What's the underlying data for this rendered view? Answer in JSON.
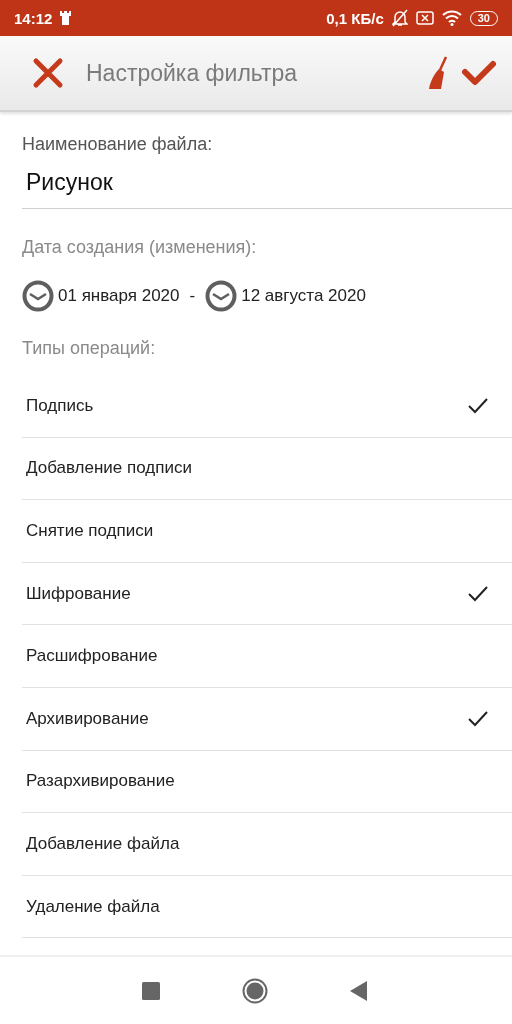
{
  "status_bar": {
    "time": "14:12",
    "speed": "0,1 КБ/с",
    "battery": "30"
  },
  "toolbar": {
    "title": "Настройка фильтра"
  },
  "file_name": {
    "label": "Наименование файла:",
    "value": "Рисунок"
  },
  "date_range": {
    "label": "Дата создания (изменения):",
    "from": "01 января 2020",
    "separator": "-",
    "to": "12 августа 2020"
  },
  "operations": {
    "label": "Типы операций:",
    "items": [
      {
        "label": "Подпись",
        "checked": true
      },
      {
        "label": "Добавление подписи",
        "checked": false
      },
      {
        "label": "Снятие подписи",
        "checked": false
      },
      {
        "label": "Шифрование",
        "checked": true
      },
      {
        "label": "Расшифрование",
        "checked": false
      },
      {
        "label": "Архивирование",
        "checked": true
      },
      {
        "label": "Разархивирование",
        "checked": false
      },
      {
        "label": "Добавление файла",
        "checked": false
      },
      {
        "label": "Удаление файла",
        "checked": false
      }
    ]
  }
}
